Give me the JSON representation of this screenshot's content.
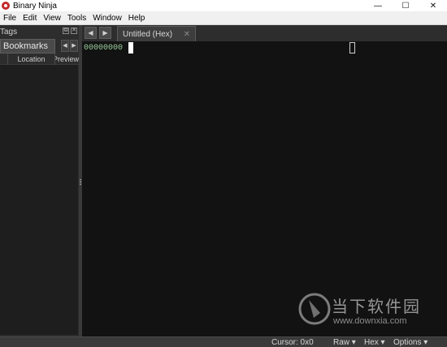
{
  "window": {
    "title": "Binary Ninja",
    "minimize": "—",
    "maximize": "☐",
    "close": "✕"
  },
  "menu": [
    "File",
    "Edit",
    "View",
    "Tools",
    "Window",
    "Help"
  ],
  "left_dock": {
    "tags_title": "Tags",
    "bookmarks_tab": "Bookmarks",
    "columns": [
      "Location",
      "Preview"
    ]
  },
  "editor": {
    "tab_label": "Untitled (Hex)",
    "tab_close": "✕",
    "back": "◀",
    "forward": "▶",
    "offset": "00000000"
  },
  "statusbar": {
    "cursor": "Cursor: 0x0",
    "raw": "Raw ▾",
    "hex": "Hex ▾",
    "options": "Options ▾"
  },
  "watermark": {
    "title": "当下软件园",
    "url": "www.downxia.com"
  }
}
